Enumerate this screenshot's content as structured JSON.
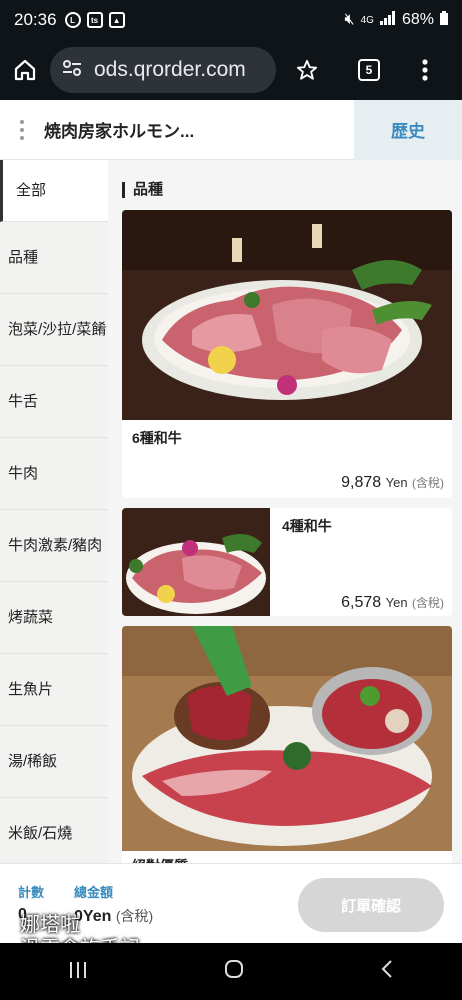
{
  "status_bar": {
    "time": "20:36",
    "battery": "68%",
    "network": "4G",
    "app_icons": [
      "LINE",
      "ts",
      "img"
    ]
  },
  "browser": {
    "url": "ods.qrorder.com",
    "tab_count": "5"
  },
  "header": {
    "store_name": "焼肉房家ホルモン...",
    "history_label": "歴史"
  },
  "sidebar": {
    "categories": [
      {
        "label": "全部",
        "active": true
      },
      {
        "label": "品種"
      },
      {
        "label": "泡菜/沙拉/菜餚"
      },
      {
        "label": "牛舌"
      },
      {
        "label": "牛肉"
      },
      {
        "label": "牛肉激素/豬肉"
      },
      {
        "label": "烤蔬菜"
      },
      {
        "label": "生魚片"
      },
      {
        "label": "湯/稀飯"
      },
      {
        "label": "米飯/石燒"
      }
    ]
  },
  "content": {
    "section_title": "品種",
    "items": [
      {
        "name": "6種和牛",
        "price": "9,878",
        "currency": "Yen",
        "tax": "(含稅)"
      },
      {
        "name": "4種和牛",
        "price": "6,578",
        "currency": "Yen",
        "tax": "(含稅)"
      },
      {
        "name": "絕對優質"
      }
    ]
  },
  "bottom_bar": {
    "count_label": "計數",
    "count_value": "0",
    "total_label": "總金額",
    "total_value": "0Yen",
    "total_tax": "(含稅)",
    "confirm_label": "訂單確認",
    "watermark_line1": "娜塔啦",
    "watermark_line2": "滑雪食旅手記"
  },
  "colors": {
    "accent_blue": "#3a8bbf",
    "history_bg": "#e6eef2",
    "disabled_button": "#d6d6d6"
  }
}
